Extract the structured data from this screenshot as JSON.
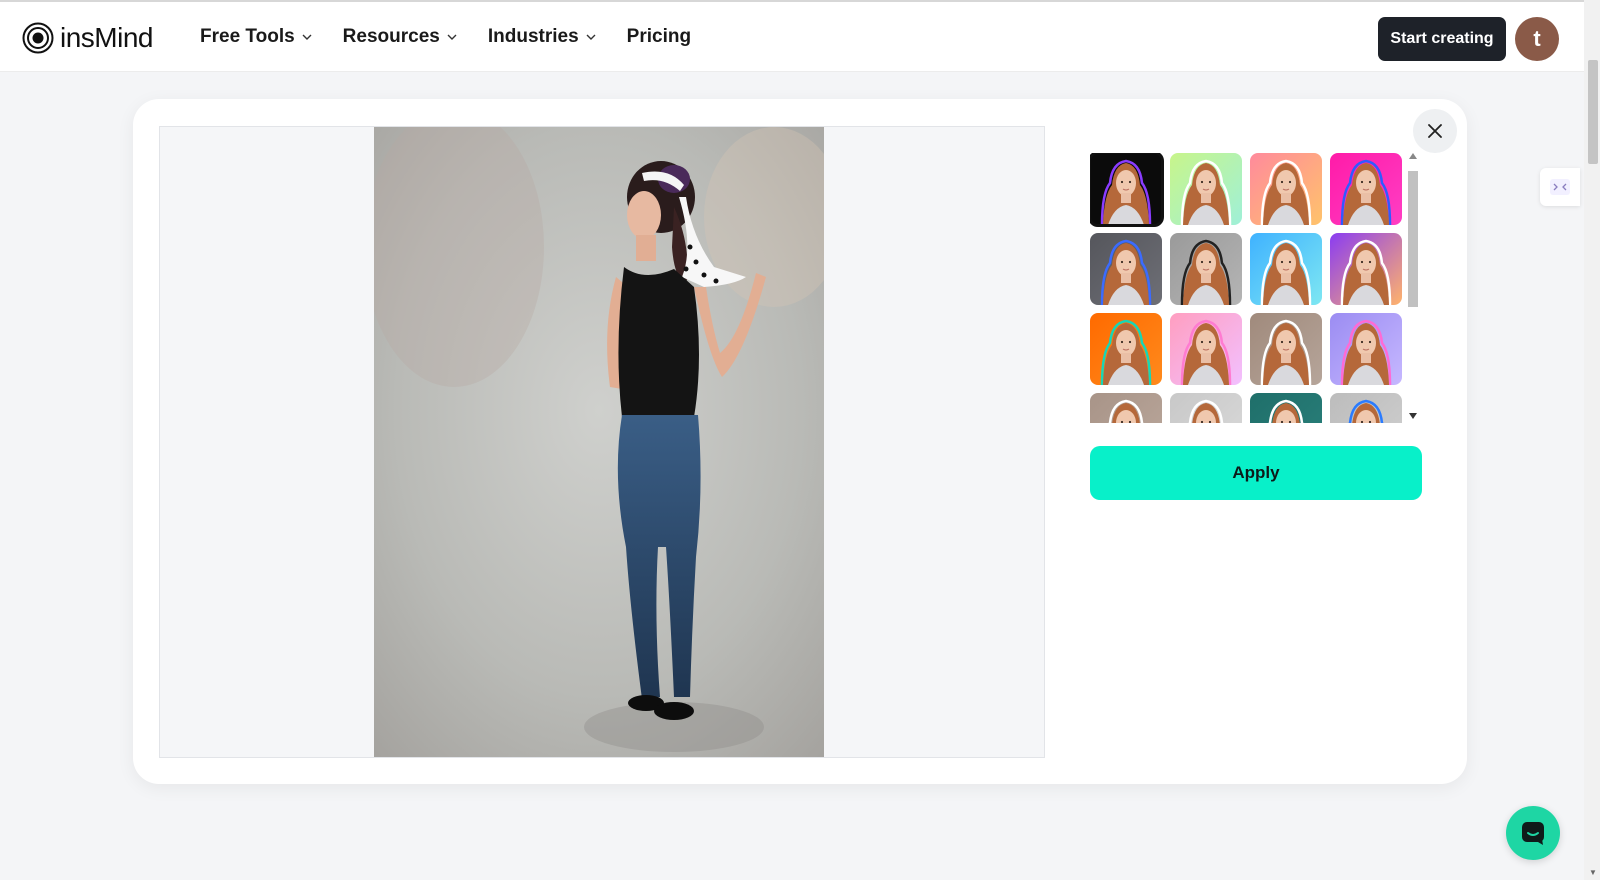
{
  "brand": {
    "name": "insMind"
  },
  "nav": {
    "items": [
      {
        "label": "Free Tools",
        "dropdown": true
      },
      {
        "label": "Resources",
        "dropdown": true
      },
      {
        "label": "Industries",
        "dropdown": true
      },
      {
        "label": "Pricing",
        "dropdown": false
      }
    ]
  },
  "header": {
    "cta_label": "Start creating",
    "avatar_initial": "t"
  },
  "modal": {
    "apply_label": "Apply",
    "close_icon": "close-icon",
    "background_options": [
      {
        "bg": "#0b0b0b",
        "outline": "#8a3cff",
        "selected": true
      },
      {
        "bg": "#c8f58a",
        "bg2": "#9ff0d8",
        "outline": "#ffffff",
        "selected": false
      },
      {
        "bg": "#ff8a9c",
        "bg2": "#ffc36b",
        "outline": "#ffffff",
        "selected": false
      },
      {
        "bg": "#ff1ba8",
        "bg2": "#ff3ec4",
        "outline": "#2f5bff",
        "selected": false
      },
      {
        "bg": "#55565c",
        "bg2": "#6e6f76",
        "outline": "#3b6bff",
        "selected": false
      },
      {
        "bg": "#9a9a9a",
        "bg2": "#b5b5b5",
        "outline": "#222222",
        "selected": false
      },
      {
        "bg": "#3fb2ff",
        "bg2": "#7ee7f2",
        "outline": "#ffffff",
        "selected": false
      },
      {
        "bg": "#8a3cf2",
        "bg2": "#ffb36b",
        "outline": "#ffffff",
        "selected": false
      },
      {
        "bg": "#ff6a00",
        "bg2": "#ff8a1c",
        "outline": "#18d6b6",
        "selected": false
      },
      {
        "bg": "#ff9ec0",
        "bg2": "#f2c0ff",
        "outline": "#ff7bd1",
        "selected": false
      },
      {
        "bg": "#a08a7c",
        "bg2": "#b6a59a",
        "outline": "#ffffff",
        "selected": false
      },
      {
        "bg": "#9b8cf2",
        "bg2": "#c6b8ff",
        "outline": "#ff6ad5",
        "selected": false
      },
      {
        "bg": "#a89488",
        "bg2": "#bba89c",
        "outline": "#ffffff",
        "selected": false
      },
      {
        "bg": "#c8c8c8",
        "bg2": "#dadada",
        "outline": "#ffffff",
        "selected": false
      },
      {
        "bg": "#1f6f6a",
        "bg2": "#2a807b",
        "outline": "#ffffff",
        "selected": false
      },
      {
        "bg": "#bcbcbc",
        "bg2": "#d0d0d0",
        "outline": "#2a7bff",
        "selected": false
      }
    ]
  },
  "colors": {
    "accent": "#08f0c9",
    "dark": "#1e2229",
    "chat": "#1ed6a4"
  }
}
